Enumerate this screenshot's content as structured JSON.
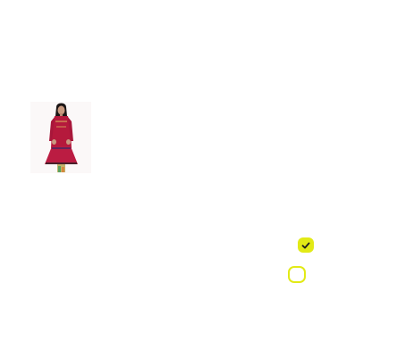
{
  "colors": {
    "accent": "#e2ea16",
    "checkmark": "#1f1f1f"
  },
  "product_image": {
    "icon": "product-photo-icon"
  },
  "checkbox_selected": {
    "icon": "checkmark-icon",
    "checked": true
  },
  "checkbox_unselected": {
    "checked": false
  }
}
